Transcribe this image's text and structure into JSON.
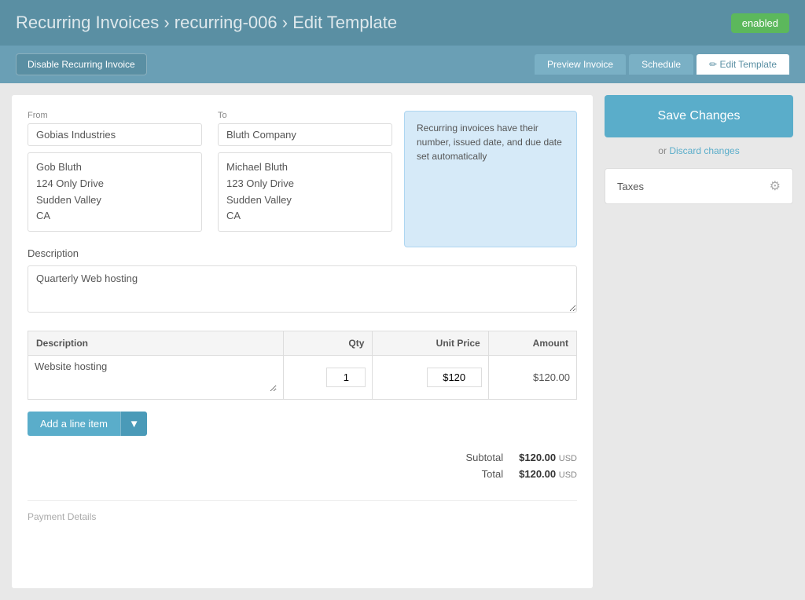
{
  "header": {
    "title": "Recurring Invoices",
    "separator1": "›",
    "breadcrumb1": "recurring-006",
    "separator2": "›",
    "breadcrumb2": "Edit Template",
    "status_badge": "enabled"
  },
  "toolbar": {
    "disable_btn": "Disable Recurring Invoice",
    "tab_preview": "Preview Invoice",
    "tab_schedule": "Schedule",
    "tab_edit": "Edit Template",
    "tab_edit_icon": "✏"
  },
  "sidebar": {
    "save_label": "Save Changes",
    "or_text": "or",
    "discard_label": "Discard changes",
    "taxes_label": "Taxes"
  },
  "form": {
    "from_label": "From",
    "from_company": "Gobias Industries",
    "from_contact": "Gob Bluth",
    "from_address": "124 Only Drive\nSudden Valley\nCA",
    "to_label": "To",
    "to_company": "Bluth Company",
    "to_contact": "Michael Bluth",
    "to_address": "123 Only Drive\nSudden Valley\nCA",
    "info_bubble": "Recurring invoices have their number, issued date, and due date set automatically",
    "description_label": "Description",
    "description_value": "Quarterly Web hosting",
    "table": {
      "col_desc": "Description",
      "col_qty": "Qty",
      "col_unit_price": "Unit Price",
      "col_amount": "Amount",
      "rows": [
        {
          "description": "Website hosting",
          "qty": "1",
          "unit_price": "$120",
          "amount": "$120.00"
        }
      ]
    },
    "add_line_label": "Add a line item",
    "subtotal_label": "Subtotal",
    "subtotal_amount": "$120.00",
    "subtotal_currency": "USD",
    "total_label": "Total",
    "total_amount": "$120.00",
    "total_currency": "USD",
    "payment_details_label": "Payment Details"
  }
}
